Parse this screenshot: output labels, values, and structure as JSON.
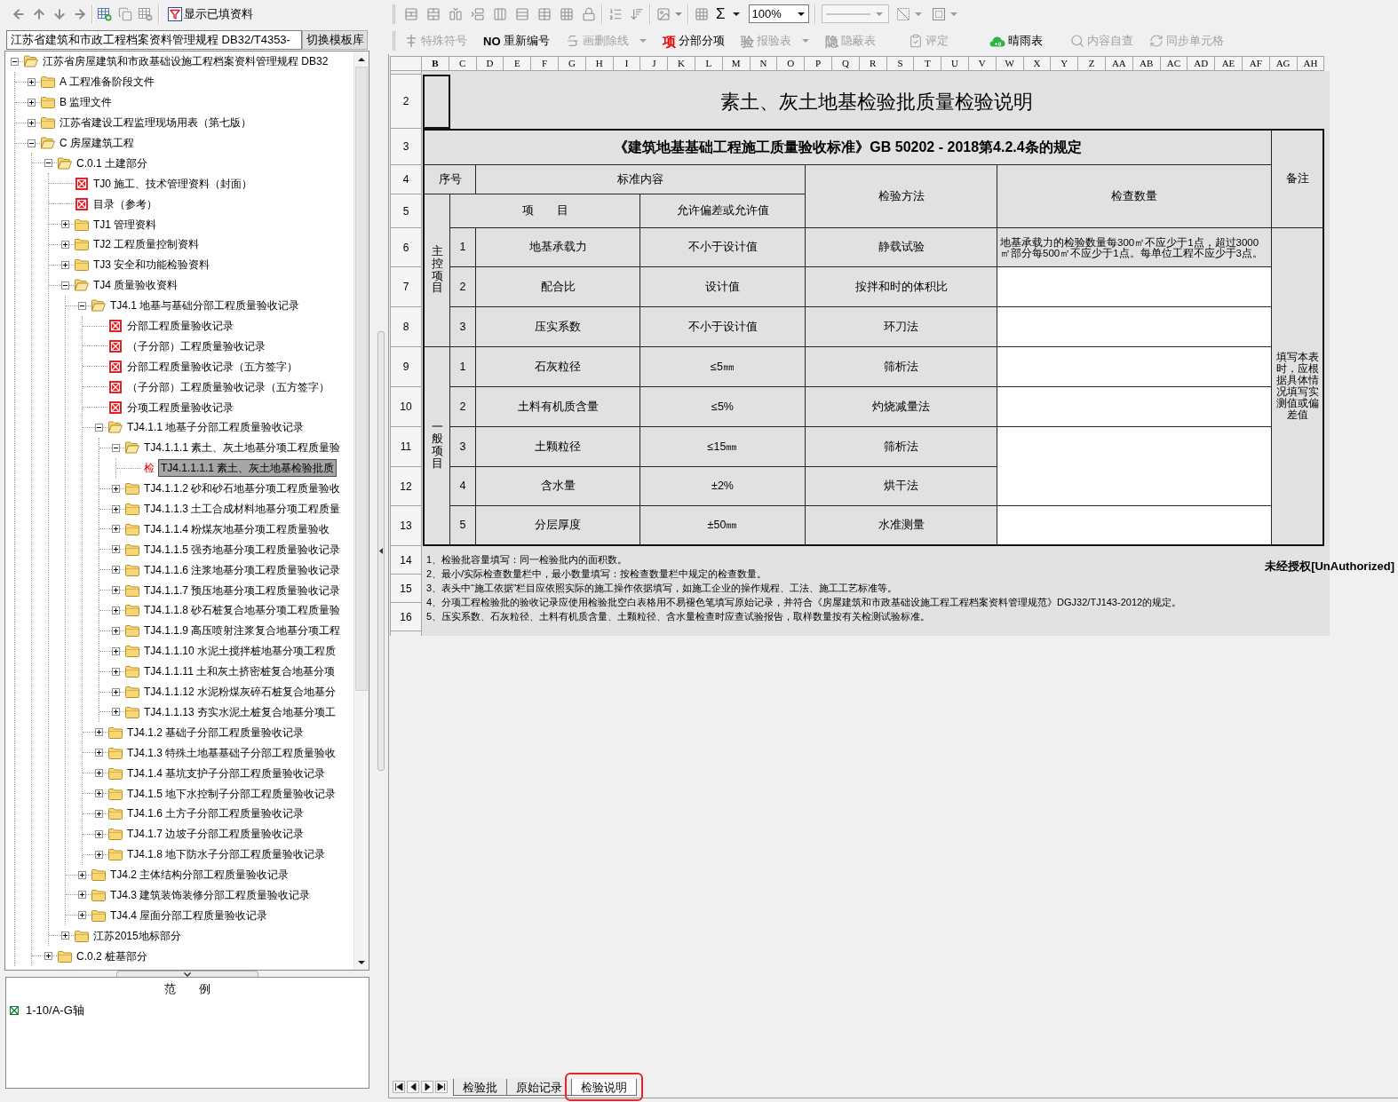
{
  "left_panel": {
    "toolbar": {
      "filter_label": "显示已填资料"
    },
    "template_select": {
      "value": "江苏省建筑和市政工程档案资料管理规程 DB32/T4353-",
      "button": "切换模板库"
    },
    "tree": [
      {
        "label": "江苏省房屋建筑和市政基础设施工程档案资料管理规程 DB32",
        "kind": "folder",
        "expanded": true,
        "selected": false,
        "children": [
          {
            "label": "A 工程准备阶段文件",
            "kind": "folder",
            "expanded": false,
            "selected": false
          },
          {
            "label": "B 监理文件",
            "kind": "folder",
            "expanded": false,
            "selected": false
          },
          {
            "label": "江苏省建设工程监理现场用表（第七版）",
            "kind": "folder",
            "expanded": false,
            "selected": false
          },
          {
            "label": "C 房屋建筑工程",
            "kind": "folder",
            "expanded": true,
            "selected": false,
            "children": [
              {
                "label": "C.0.1 土建部分",
                "kind": "folder",
                "expanded": true,
                "selected": false,
                "children": [
                  {
                    "label": "TJ0 施工、技术管理资料（封面）",
                    "kind": "form",
                    "selected": false
                  },
                  {
                    "label": "目录（参考）",
                    "kind": "form",
                    "selected": false
                  },
                  {
                    "label": "TJ1 管理资料",
                    "kind": "folder",
                    "expanded": false,
                    "selected": false
                  },
                  {
                    "label": "TJ2 工程质量控制资料",
                    "kind": "folder",
                    "expanded": false,
                    "selected": false
                  },
                  {
                    "label": "TJ3 安全和功能检验资料",
                    "kind": "folder",
                    "expanded": false,
                    "selected": false
                  },
                  {
                    "label": "TJ4 质量验收资料",
                    "kind": "folder",
                    "expanded": true,
                    "selected": false,
                    "children": [
                      {
                        "label": "TJ4.1 地基与基础分部工程质量验收记录",
                        "kind": "folder",
                        "expanded": true,
                        "selected": false,
                        "children": [
                          {
                            "label": "分部工程质量验收记录",
                            "kind": "form",
                            "selected": false
                          },
                          {
                            "label": "（子分部）工程质量验收记录",
                            "kind": "form",
                            "selected": false
                          },
                          {
                            "label": "分部工程质量验收记录（五方签字）",
                            "kind": "form",
                            "selected": false
                          },
                          {
                            "label": "（子分部）工程质量验收记录（五方签字）",
                            "kind": "form",
                            "selected": false
                          },
                          {
                            "label": "分项工程质量验收记录",
                            "kind": "form",
                            "selected": false
                          },
                          {
                            "label": "TJ4.1.1 地基子分部工程质量验收记录",
                            "kind": "folder",
                            "expanded": true,
                            "selected": false,
                            "children": [
                              {
                                "label": "TJ4.1.1.1 素土、灰土地基分项工程质量验",
                                "kind": "folder",
                                "expanded": true,
                                "selected": false,
                                "children": [
                                  {
                                    "label": "TJ4.1.1.1.1 素土、灰土地基检验批质",
                                    "kind": "batch",
                                    "icon_text": "检",
                                    "selected": true
                                  }
                                ]
                              },
                              {
                                "label": "TJ4.1.1.2 砂和砂石地基分项工程质量验收",
                                "kind": "folder",
                                "expanded": false,
                                "selected": false
                              },
                              {
                                "label": "TJ4.1.1.3 土工合成材料地基分项工程质量",
                                "kind": "folder",
                                "expanded": false,
                                "selected": false
                              },
                              {
                                "label": "TJ4.1.1.4 粉煤灰地基分项工程质量验收",
                                "kind": "folder",
                                "expanded": false,
                                "selected": false
                              },
                              {
                                "label": "TJ4.1.1.5 强夯地基分项工程质量验收记录",
                                "kind": "folder",
                                "expanded": false,
                                "selected": false
                              },
                              {
                                "label": "TJ4.1.1.6 注浆地基分项工程质量验收记录",
                                "kind": "folder",
                                "expanded": false,
                                "selected": false
                              },
                              {
                                "label": "TJ4.1.1.7 预压地基分项工程质量验收记录",
                                "kind": "folder",
                                "expanded": false,
                                "selected": false
                              },
                              {
                                "label": "TJ4.1.1.8 砂石桩复合地基分项工程质量验",
                                "kind": "folder",
                                "expanded": false,
                                "selected": false
                              },
                              {
                                "label": "TJ4.1.1.9 高压喷射注浆复合地基分项工程",
                                "kind": "folder",
                                "expanded": false,
                                "selected": false
                              },
                              {
                                "label": "TJ4.1.1.10 水泥土搅拌桩地基分项工程质",
                                "kind": "folder",
                                "expanded": false,
                                "selected": false
                              },
                              {
                                "label": "TJ4.1.1.11 土和灰土挤密桩复合地基分项",
                                "kind": "folder",
                                "expanded": false,
                                "selected": false
                              },
                              {
                                "label": "TJ4.1.1.12 水泥粉煤灰碎石桩复合地基分",
                                "kind": "folder",
                                "expanded": false,
                                "selected": false
                              },
                              {
                                "label": "TJ4.1.1.13 夯实水泥土桩复合地基分项工",
                                "kind": "folder",
                                "expanded": false,
                                "selected": false
                              }
                            ]
                          },
                          {
                            "label": "TJ4.1.2 基础子分部工程质量验收记录",
                            "kind": "folder",
                            "expanded": false,
                            "selected": false
                          },
                          {
                            "label": "TJ4.1.3 特殊土地基基础子分部工程质量验收",
                            "kind": "folder",
                            "expanded": false,
                            "selected": false
                          },
                          {
                            "label": "TJ4.1.4 基坑支护子分部工程质量验收记录",
                            "kind": "folder",
                            "expanded": false,
                            "selected": false
                          },
                          {
                            "label": "TJ4.1.5 地下水控制子分部工程质量验收记录",
                            "kind": "folder",
                            "expanded": false,
                            "selected": false
                          },
                          {
                            "label": "TJ4.1.6 土方子分部工程质量验收记录",
                            "kind": "folder",
                            "expanded": false,
                            "selected": false
                          },
                          {
                            "label": "TJ4.1.7 边坡子分部工程质量验收记录",
                            "kind": "folder",
                            "expanded": false,
                            "selected": false
                          },
                          {
                            "label": "TJ4.1.8 地下防水子分部工程质量验收记录",
                            "kind": "folder",
                            "expanded": false,
                            "selected": false
                          }
                        ]
                      },
                      {
                        "label": "TJ4.2 主体结构分部工程质量验收记录",
                        "kind": "folder",
                        "expanded": false,
                        "selected": false
                      },
                      {
                        "label": "TJ4.3 建筑装饰装修分部工程质量验收记录",
                        "kind": "folder",
                        "expanded": false,
                        "selected": false
                      },
                      {
                        "label": "TJ4.4 屋面分部工程质量验收记录",
                        "kind": "folder",
                        "expanded": false,
                        "selected": false
                      }
                    ]
                  },
                  {
                    "label": "江苏2015地标部分",
                    "kind": "folder",
                    "expanded": false,
                    "selected": false
                  }
                ]
              },
              {
                "label": "C.0.2 桩基部分",
                "kind": "folder",
                "expanded": false,
                "selected": false
              }
            ]
          }
        ]
      }
    ],
    "legend": {
      "title": "范　　例",
      "items": [
        {
          "label": "1-10/A-G轴"
        }
      ]
    }
  },
  "right_panel": {
    "toolbar": {
      "sum_symbol": "Σ",
      "zoom": "100%"
    },
    "toolbar2": [
      {
        "kind": "symbol",
        "label": "特殊符号",
        "disabled": true,
        "has_menu": false
      },
      {
        "kind": "renumber",
        "icon_text": "NO",
        "label": "重新编号",
        "disabled": false,
        "has_menu": false
      },
      {
        "kind": "strike",
        "label": "画删除线",
        "disabled": true,
        "has_menu": true
      },
      {
        "kind": "subitem",
        "icon_text": "项",
        "label": "分部分项",
        "disabled": false,
        "has_menu": false
      },
      {
        "kind": "report",
        "icon_text": "验",
        "label": "报验表",
        "disabled": true,
        "has_menu": true
      },
      {
        "kind": "hidden",
        "icon_text": "隐",
        "label": "隐蔽表",
        "disabled": true,
        "has_menu": false
      },
      {
        "kind": "rating",
        "label": "评定",
        "disabled": true,
        "has_menu": false
      },
      {
        "kind": "weather",
        "label": "晴雨表",
        "disabled": false,
        "has_menu": false
      },
      {
        "kind": "review",
        "label": "内容自查",
        "disabled": true,
        "has_menu": false
      },
      {
        "kind": "sync",
        "label": "同步单元格",
        "disabled": true,
        "has_menu": false
      }
    ],
    "sheet": {
      "columns": [
        {
          "label": "B",
          "selected": true
        },
        {
          "label": "C",
          "selected": false
        },
        {
          "label": "D",
          "selected": false
        },
        {
          "label": "E",
          "selected": false
        },
        {
          "label": "F",
          "selected": false
        },
        {
          "label": "G",
          "selected": false
        },
        {
          "label": "H",
          "selected": false
        },
        {
          "label": "I",
          "selected": false
        },
        {
          "label": "J",
          "selected": false
        },
        {
          "label": "K",
          "selected": false
        },
        {
          "label": "L",
          "selected": false
        },
        {
          "label": "M",
          "selected": false
        },
        {
          "label": "N",
          "selected": false
        },
        {
          "label": "O",
          "selected": false
        },
        {
          "label": "P",
          "selected": false
        },
        {
          "label": "Q",
          "selected": false
        },
        {
          "label": "R",
          "selected": false
        },
        {
          "label": "S",
          "selected": false
        },
        {
          "label": "T",
          "selected": false
        },
        {
          "label": "U",
          "selected": false
        },
        {
          "label": "V",
          "selected": false
        },
        {
          "label": "W",
          "selected": false
        },
        {
          "label": "X",
          "selected": false
        },
        {
          "label": "Y",
          "selected": false
        },
        {
          "label": "Z",
          "selected": false
        },
        {
          "label": "AA",
          "selected": false
        },
        {
          "label": "AB",
          "selected": false
        },
        {
          "label": "AC",
          "selected": false
        },
        {
          "label": "AD",
          "selected": false
        },
        {
          "label": "AE",
          "selected": false
        },
        {
          "label": "AF",
          "selected": false
        },
        {
          "label": "AG",
          "selected": false
        },
        {
          "label": "AH",
          "selected": false
        }
      ],
      "row_numbers": [
        "2",
        "3",
        "4",
        "5",
        "6",
        "7",
        "8",
        "9",
        "10",
        "11",
        "12",
        "13",
        "14",
        "15",
        "16"
      ],
      "form": {
        "title": "素土、灰土地基检验批质量检验说明",
        "standard": "《建筑地基基础工程施工质量验收标准》GB 50202 - 2018第4.2.4条的规定",
        "header": {
          "seq": "序号",
          "content": "标准内容",
          "item": "项　　目",
          "tolerance": "允许偏差或允许值",
          "method": "检验方法",
          "quantity": "检查数量",
          "remarks": "备注"
        },
        "groups": [
          {
            "name": "主控项目",
            "rows": [
              {
                "no": "1",
                "item": "地基承载力",
                "tolerance": "不小于设计值",
                "method": "静载试验",
                "quantity": "地基承载力的检验数量每300㎡不应少于1点，超过3000㎡部分每500㎡不应少于1点。每单位工程不应少于3点。",
                "quantity_joined_below": false
              },
              {
                "no": "2",
                "item": "配合比",
                "tolerance": "设计值",
                "method": "按拌和时的体积比",
                "quantity_joined_below": false
              },
              {
                "no": "3",
                "item": "压实系数",
                "tolerance": "不小于设计值",
                "method": "环刀法",
                "quantity_joined_below": false
              }
            ]
          },
          {
            "name": "一般项目",
            "rows": [
              {
                "no": "1",
                "item": "石灰粒径",
                "tolerance": "≤5㎜",
                "method": "筛析法",
                "quantity_joined_below": false
              },
              {
                "no": "2",
                "item": "土料有机质含量",
                "tolerance": "≤5%",
                "method": "灼烧减量法",
                "quantity_joined_below": false
              },
              {
                "no": "3",
                "item": "土颗粒径",
                "tolerance": "≤15㎜",
                "method": "筛析法",
                "quantity_joined_below": true
              },
              {
                "no": "4",
                "item": "含水量",
                "tolerance": "±2%",
                "method": "烘干法",
                "quantity_joined_below": false
              },
              {
                "no": "5",
                "item": "分层厚度",
                "tolerance": "±50㎜",
                "method": "水准测量",
                "quantity_joined_below": false
              }
            ]
          }
        ],
        "remarks_text": "填写本表时，应根据具体情况填写实测值或偏差值",
        "notes": [
          "1、检验批容量填写：同一检验批内的面积数。",
          "2、最小/实际检查数量栏中，最小数量填写：按检查数量栏中规定的检查数量。",
          "3、表头中“施工依据”栏目应依照实际的施工操作依据填写，如施工企业的操作规程、工法、施工工艺标准等。",
          "4、分项工程检验批的验收记录应使用检验批空白表格用不易褪色笔填写原始记录，并符合《房屋建筑和市政基础设施工程工程档案资料管理规范》DGJ32/TJ143-2012的规定。",
          "5、压实系数、石灰粒径、土料有机质含量、土颗粒径、含水量检查时应查试验报告，取样数量按有关检测试验标准。"
        ]
      },
      "unauthorized_label": "未经授权[UnAuthorized]"
    },
    "sheet_tabs": [
      {
        "label": "检验批",
        "selected": false,
        "highlighted": false
      },
      {
        "label": "原始记录",
        "selected": false,
        "highlighted": false
      },
      {
        "label": "检验说明",
        "selected": true,
        "highlighted": true
      }
    ]
  }
}
